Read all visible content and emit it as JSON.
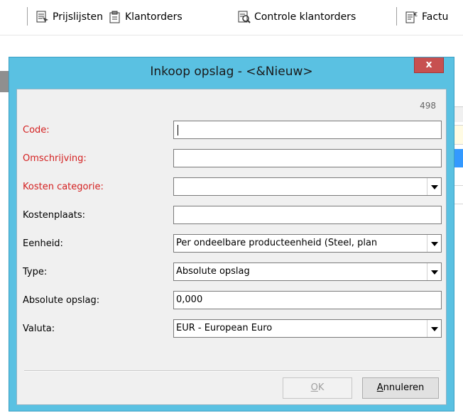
{
  "toolbar": {
    "items": [
      {
        "label": "Prijslijsten",
        "icon": "price-list-icon"
      },
      {
        "label": "Klantorders",
        "icon": "customer-orders-icon"
      },
      {
        "label": "Controle klantorders",
        "icon": "check-orders-icon"
      },
      {
        "label": "Factu",
        "icon": "invoice-icon"
      }
    ]
  },
  "dialog": {
    "title": "Inkoop opslag - <&Nieuw>",
    "close_glyph": "x",
    "counter": "498",
    "fields": {
      "code": {
        "label": "Code:",
        "value": ""
      },
      "omschrijving": {
        "label": "Omschrijving:",
        "value": ""
      },
      "kosten_categorie": {
        "label": "Kosten categorie:",
        "value": ""
      },
      "kostenplaats": {
        "label": "Kostenplaats:",
        "value": ""
      },
      "eenheid": {
        "label": "Eenheid:",
        "value": "Per ondeelbare producteenheid (Steel, plan"
      },
      "type": {
        "label": "Type:",
        "value": "Absolute opslag"
      },
      "absolute_opslag": {
        "label": "Absolute opslag:",
        "value": "0,000"
      },
      "valuta": {
        "label": "Valuta:",
        "value": "EUR - European Euro"
      }
    },
    "buttons": {
      "ok_label": "OK",
      "ok_mnemonic": "O",
      "ok_rest": "K",
      "cancel_label": "Annuleren",
      "cancel_mnemonic": "A",
      "cancel_rest": "nnuleren"
    }
  },
  "colors": {
    "title_bar": "#5ac1e2",
    "required_label": "#d42020",
    "close_button": "#c75050"
  }
}
